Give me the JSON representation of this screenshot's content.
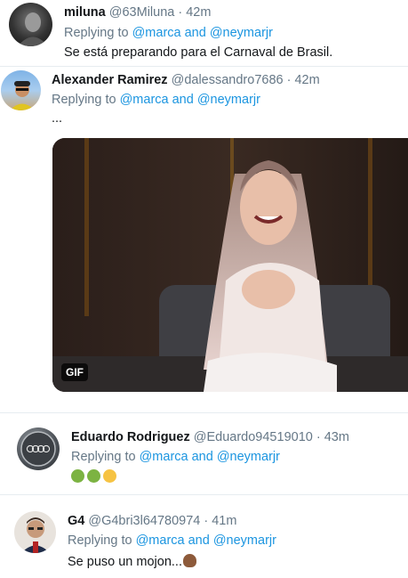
{
  "replies": [
    {
      "name": "miluna",
      "handle": "@63Miluna",
      "time": "· 42m",
      "replying_prefix": "Replying to",
      "replying_links": "@marca and @neymarjr",
      "text": "Se está preparando para el Carnaval de Brasil.",
      "avatar_icon": "dark-portrait-avatar"
    },
    {
      "name": "Alexander Ramirez",
      "handle": "@dalessandro7686",
      "time": "· 42m",
      "replying_prefix": "Replying to",
      "replying_links": "@marca and @neymarjr",
      "text": "...",
      "avatar_icon": "man-with-cap-avatar",
      "media": {
        "badge": "GIF",
        "icon": "gif-woman-laughing"
      }
    },
    {
      "name": "Eduardo Rodriguez",
      "handle": "@Eduardo94519010",
      "time": "· 43m",
      "replying_prefix": "Replying to",
      "replying_links": "@marca and @neymarjr",
      "emojis": [
        "nauseated-face",
        "nauseated-face",
        "vomiting-face"
      ],
      "avatar_icon": "audi-logo-avatar"
    },
    {
      "name": "G4",
      "handle": "@G4bri3l64780974",
      "time": "· 41m",
      "replying_prefix": "Replying to",
      "replying_links": "@marca and @neymarjr",
      "text": "Se puso un mojon...",
      "trailing_emoji": "pile-of-poo",
      "avatar_icon": "man-with-glasses-avatar"
    }
  ],
  "colors": {
    "link": "#1b95e0",
    "secondary": "#657786",
    "primary": "#14171a",
    "separator": "#e6ecf0"
  }
}
